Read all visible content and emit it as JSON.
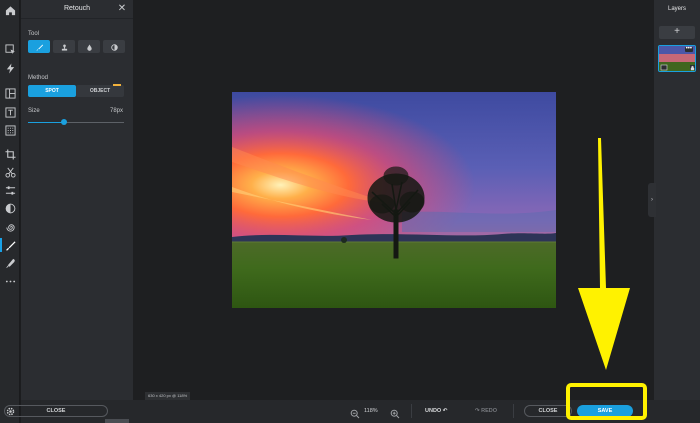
{
  "app": {
    "accent": "#1aa0df",
    "highlight": "#fff200"
  },
  "rail": {
    "items": [
      {
        "icon": "home-icon"
      },
      {
        "icon": "select-arrow-icon"
      },
      {
        "icon": "lightning-icon"
      },
      {
        "icon": "layout-icon"
      },
      {
        "icon": "text-icon"
      },
      {
        "icon": "texture-icon"
      },
      {
        "icon": "crop-icon"
      },
      {
        "icon": "scissors-icon"
      },
      {
        "icon": "adjust-sliders-icon"
      },
      {
        "icon": "filter-circle-icon"
      },
      {
        "icon": "spiral-icon"
      },
      {
        "icon": "retouch-brush-icon"
      },
      {
        "icon": "draw-brush-icon"
      },
      {
        "icon": "more-dots-icon"
      },
      {
        "icon": "gear-icon"
      }
    ]
  },
  "panel": {
    "title": "Retouch",
    "tool_label": "Tool",
    "tools": [
      {
        "icon": "brush-icon",
        "selected": true
      },
      {
        "icon": "stamp-icon",
        "selected": false
      },
      {
        "icon": "drop-icon",
        "selected": false
      },
      {
        "icon": "contrast-icon",
        "selected": false
      }
    ],
    "method_label": "Method",
    "method_options": [
      "SPOT",
      "OBJECT"
    ],
    "method_selected": "SPOT",
    "size_label": "Size",
    "size_value": "78px",
    "size_fraction": 0.38,
    "close_label": "CLOSE"
  },
  "canvas": {
    "dimensions": "630 x 420 px @ 118%"
  },
  "bottombar": {
    "zoom": "118%",
    "undo": "UNDO",
    "redo": "REDO",
    "close": "CLOSE",
    "save": "SAVE"
  },
  "layers": {
    "title": "Layers",
    "add": "+"
  }
}
